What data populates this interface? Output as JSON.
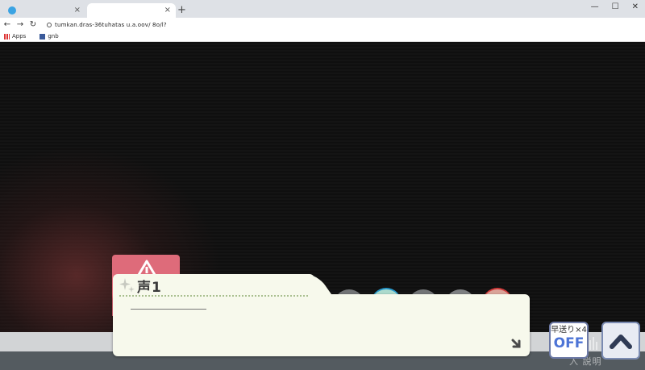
{
  "browser": {
    "tabs": [
      {
        "label": ""
      },
      {
        "label": ""
      }
    ],
    "new_tab": "+",
    "close_glyph": "×",
    "window_controls": [
      "—",
      "☐",
      "✕"
    ],
    "nav": {
      "back": "←",
      "forward": "→",
      "reload": "↻"
    },
    "url": "tumkan.dras-36tuhatas u.a.oov/ 8o/l?",
    "bookmarks": [
      {
        "label": "Apps",
        "icon": "apps-grid-icon"
      },
      {
        "label": "gnb",
        "icon": "bookmark-favicon-icon"
      }
    ]
  },
  "game": {
    "speaker": "声1",
    "dialogue": "",
    "fast_forward": {
      "label": "早送り×4",
      "state": "OFF"
    },
    "ghost_text": "入 説明",
    "colors": {
      "char_tab": "#de6b7a",
      "dialog_bg": "#f7f9ec",
      "ff_text": "#4d74d6",
      "circle_1": "#e6f1e1",
      "circle_2": "#c8f2e2",
      "circle_3": "#7d8082",
      "circle_4": "#bdf1e2",
      "circle_5": "#7d8082",
      "circle_6": "#8a8c8e",
      "circle_7": "#f0b4a8"
    }
  }
}
